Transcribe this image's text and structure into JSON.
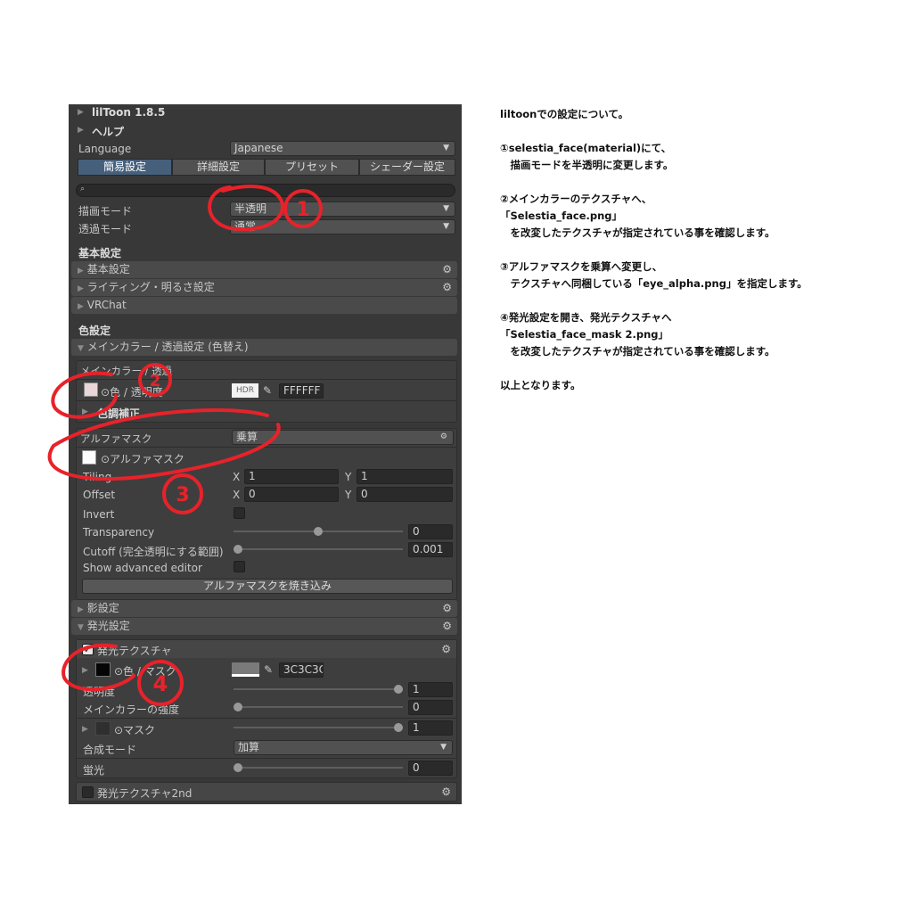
{
  "panel": {
    "title": "lilToon 1.8.5",
    "help": "ヘルプ",
    "language_label": "Language",
    "language_value": "Japanese",
    "tabs": [
      "簡易設定",
      "詳細設定",
      "プリセット",
      "シェーダー設定"
    ],
    "search_placeholder": "",
    "render_mode_label": "描画モード",
    "render_mode_value": "半透明",
    "transparent_mode_label": "透過モード",
    "transparent_mode_value": "通常",
    "basic_header": "基本設定",
    "sections_basic": [
      "基本設定",
      "ライティング・明るさ設定",
      "VRChat"
    ],
    "color_header": "色設定",
    "main_color_section": "メインカラー / 透過設定 (色替え)",
    "main_color_box_title": "メインカラー / 透過",
    "main_color_tex_label": "⊙色 / 透明度",
    "hdr_label": "HDR",
    "main_color_hex": "FFFFFF",
    "color_correction": "色調補正",
    "alpha_mask_label": "アルファマスク",
    "alpha_mask_mode": "乗算",
    "alpha_mask_tex_label": "⊙アルファマスク",
    "tiling_label": "Tiling",
    "offset_label": "Offset",
    "x_label": "X",
    "y_label": "Y",
    "tiling_x": "1",
    "tiling_y": "1",
    "offset_x": "0",
    "offset_y": "0",
    "invert_label": "Invert",
    "transparency_label": "Transparency",
    "transparency_value": "0",
    "transparency_slider": 0.5,
    "cutoff_label": "Cutoff (完全透明にする範囲)",
    "cutoff_value": "0.001",
    "cutoff_slider": 0.0,
    "advanced_label": "Show advanced editor",
    "bake_button": "アルファマスクを焼き込み",
    "shadow_section": "影設定",
    "emission_section": "発光設定",
    "emission_tex_label": "発光テクスチャ",
    "emission_color_label": "⊙色 / マスク",
    "emission_hex": "3C3C3C",
    "emission_opacity_label": "透明度",
    "emission_opacity_value": "1",
    "emission_opacity_slider": 1.0,
    "main_color_strength_label": "メインカラーの強度",
    "main_color_strength_value": "0",
    "main_color_strength_slider": 0.0,
    "mask_label": "⊙マスク",
    "mask_value": "1",
    "mask_slider": 1.0,
    "blend_mode_label": "合成モード",
    "blend_mode_value": "加算",
    "fluorescence_label": "蛍光",
    "fluorescence_value": "0",
    "fluorescence_slider": 0.0,
    "emission2_label": "発光テクスチャ2nd"
  },
  "annotations": [
    "1",
    "2",
    "3",
    "4"
  ],
  "notes": {
    "line1": "liltoonでの設定について。",
    "line2": "①selestia_face(material)にて、",
    "line3": "　描画モードを半透明に変更します。",
    "line4": "②メインカラーのテクスチャへ、",
    "line5": "「Selestia_face.png」",
    "line6": "　を改変したテクスチャが指定されている事を確認します。",
    "line7": "③アルファマスクを乗算へ変更し、",
    "line8": "　テクスチャへ同梱している「eye_alpha.png」を指定します。",
    "line9": "④発光設定を開き、発光テクスチャへ",
    "line10": "「Selestia_face_mask 2.png」",
    "line11": "　を改変したテクスチャが指定されている事を確認します。",
    "line12": "以上となります。"
  },
  "colors": {
    "panel_bg": "#383838",
    "active_tab": "#46607c",
    "annotation_red": "#e8222a"
  }
}
